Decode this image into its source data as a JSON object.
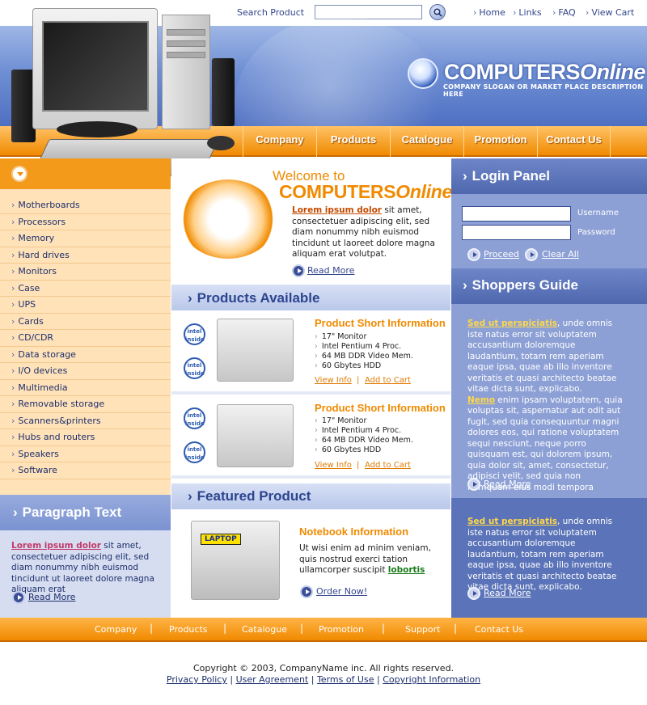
{
  "search": {
    "label": "Search Product",
    "placeholder": "",
    "button_icon": "search-icon"
  },
  "top_links": [
    "Home",
    "Links",
    "FAQ",
    "View Cart"
  ],
  "brand": {
    "name_part1": "COMPUTERS",
    "name_part2": "Online",
    "slogan": "COMPANY SLOGAN OR MARKET PLACE DESCRIPTION HERE"
  },
  "colors": {
    "orange": "#f08a00",
    "blue": "#5b73b8",
    "light_blue": "#8da0d5",
    "dark_blue": "#2d458f"
  },
  "nav": [
    "Company",
    "Products",
    "Catalogue",
    "Promotion",
    "Contact Us"
  ],
  "categories": [
    "Motherboards",
    "Processors",
    "Memory",
    "Hard drives",
    "Monitors",
    "Case",
    "UPS",
    "Cards",
    "CD/CDR",
    "Data storage",
    "I/O devices",
    "Multimedia",
    "Removable storage",
    "Scanners&printers",
    "Hubs and routers",
    "Speakers",
    "Software"
  ],
  "paragraph": {
    "title": "Paragraph Text",
    "link": "Lorem ipsum dolor",
    "text": " sit amet, consectetuer adipiscing elit, sed diam nonummy nibh euismod tincidunt ut laoreet dolore magna aliquam erat",
    "read_more": "Read More"
  },
  "welcome": {
    "line1": "Welcome to",
    "line2a": "COMPUTERS",
    "line2b": "Online",
    "link": "Lorem ipsum dolor",
    "text": " sit amet, consectetuer adipiscing elit, sed diam nonummy nibh euismod tincidunt ut laoreet dolore magna aliquam erat volutpat.",
    "read_more": "Read More"
  },
  "products": {
    "title": "Products Available",
    "items": [
      {
        "title": "Product Short Information",
        "specs": [
          "17\" Monitor",
          "Intel Pentium 4 Proc.",
          "64 MB DDR Video Mem.",
          "60 Gbytes HDD"
        ],
        "view": "View Info",
        "cart": "Add to Cart"
      },
      {
        "title": "Product Short Information",
        "specs": [
          "17\" Monitor",
          "Intel Pentium 4 Proc.",
          "64 MB DDR Video Mem.",
          "60 Gbytes HDD"
        ],
        "view": "View Info",
        "cart": "Add to Cart"
      }
    ]
  },
  "featured": {
    "title": "Featured Product",
    "item_title": "Notebook Information",
    "text": "Ut wisi enim ad minim veniam, quis nostrud exerci tation ullamcorper suscipit ",
    "link": "lobortis",
    "badge": "LAPTOP",
    "button": "Order Now!"
  },
  "login": {
    "title": "Login Panel",
    "username_label": "Username",
    "password_label": "Password",
    "proceed": "Proceed",
    "clear": "Clear All"
  },
  "guide": {
    "title": "Shoppers Guide",
    "p1_link": "Sed ut perspiciatis",
    "p1_text": ", unde omnis iste natus error sit voluptatem accusantium doloremque laudantium, totam rem aperiam eaque ipsa, quae ab illo inventore veritatis et quasi architecto beatae vitae dicta sunt, explicabo.",
    "p2_link": "Nemo",
    "p2_text": " enim ipsam voluptatem, quia voluptas sit, aspernatur aut odit aut fugit, sed quia consequuntur magni dolores eos, qui ratione voluptatem sequi nesciunt, neque porro quisquam est, qui dolorem ipsum, quia dolor sit, amet, consectetur, adipisci velit, sed quia non numquam eius modi tempora",
    "read_more": "Read More",
    "p3_link": "Sed ut perspiciatis",
    "p3_text": ", unde omnis iste natus error sit voluptatem accusantium doloremque laudantium, totam rem aperiam eaque ipsa, quae ab illo inventore veritatis et quasi architecto beatae vitae dicta sunt, explicabo.",
    "read_more2": "Read More"
  },
  "footer_nav": [
    "Company",
    "Products",
    "Catalogue",
    "Promotion",
    "Support",
    "Contact Us"
  ],
  "footer": {
    "copyright": "Copyright © 2003, CompanyName inc. All rights reserved.",
    "links": [
      "Privacy Policy",
      "User Agreement",
      "Terms of Use",
      "Copyright Information"
    ]
  }
}
